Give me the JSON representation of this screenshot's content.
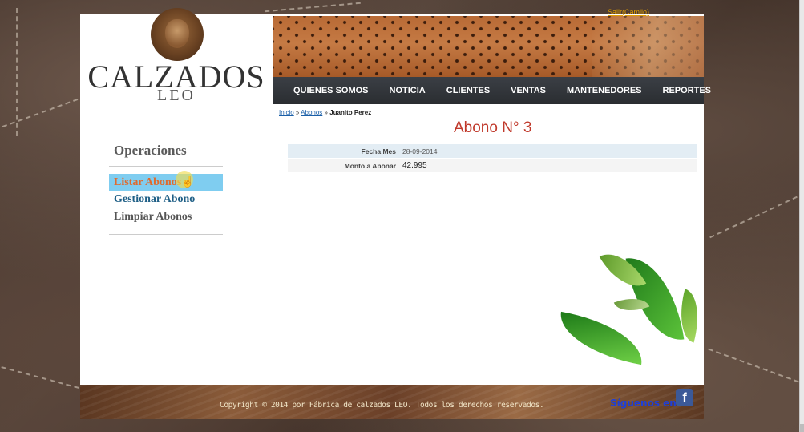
{
  "header": {
    "brand": "CALZADOS",
    "brand_sub": "LEO",
    "user_link": "Salir(Camilo)"
  },
  "nav": {
    "items": [
      "QUIENES SOMOS",
      "NOTICIA",
      "CLIENTES",
      "VENTAS",
      "MANTENEDORES",
      "REPORTES"
    ]
  },
  "breadcrumb": {
    "home": "Inicio",
    "sep": "»",
    "section": "Abonos",
    "current": "Juanito Perez"
  },
  "main": {
    "title": "Abono N° 3",
    "fields": [
      {
        "label": "Fecha Mes",
        "value": "28-09-2014"
      },
      {
        "label": "Monto a Abonar",
        "value": "42.995"
      }
    ]
  },
  "sidebar": {
    "title": "Operaciones",
    "items": [
      "Listar Abonos",
      "Gestionar Abono",
      "Limpiar Abonos"
    ],
    "active_index": 0
  },
  "footer": {
    "copyright": "Copyright © 2014 por Fábrica de calzados LEO. Todos los derechos reservados.",
    "follow": "Síguenos en:",
    "facebook": "f"
  },
  "colors": {
    "accent_title": "#c0392b",
    "menu_active_bg": "#7fcdf0",
    "menu_active_text": "#e06a2d",
    "nav_bg": "#2a2d31"
  },
  "icons": [
    "lion-logo-icon",
    "facebook-icon",
    "hand-cursor-icon"
  ]
}
